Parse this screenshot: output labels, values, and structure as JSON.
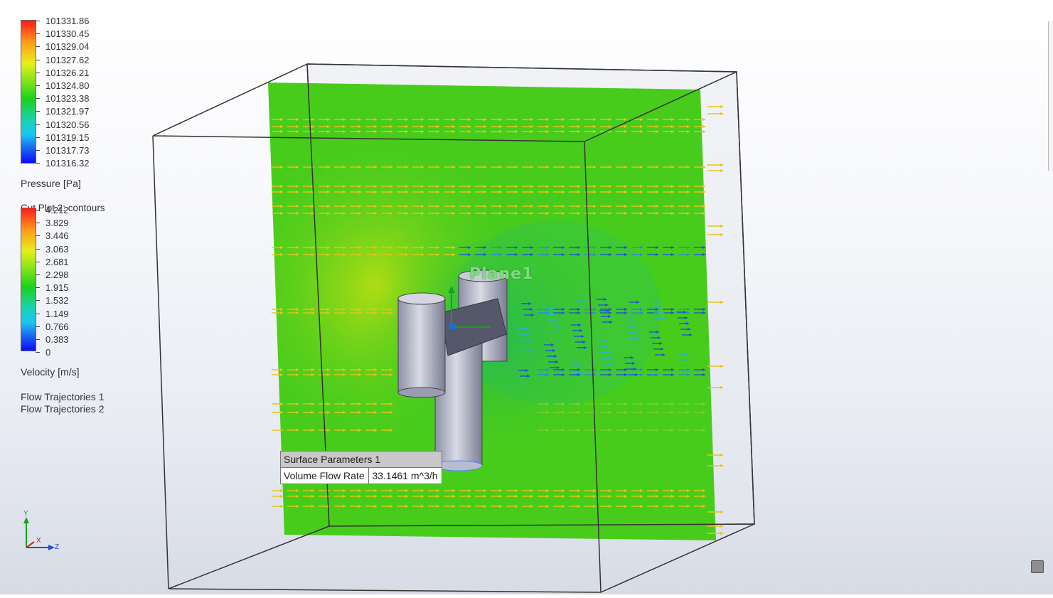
{
  "pressure_legend": {
    "ticks": [
      "101331.86",
      "101330.45",
      "101329.04",
      "101327.62",
      "101326.21",
      "101324.80",
      "101323.38",
      "101321.97",
      "101320.56",
      "101319.15",
      "101317.73",
      "101316.32"
    ],
    "title": "Pressure [Pa]"
  },
  "velocity_legend": {
    "header": "Cut Plot 2: contours",
    "ticks": [
      "4.212",
      "3.829",
      "3.446",
      "3.063",
      "2.681",
      "2.298",
      "1.915",
      "1.532",
      "1.149",
      "0.766",
      "0.383",
      "0"
    ],
    "title": "Velocity [m/s]"
  },
  "trajectories": [
    "Flow Trajectories 1",
    "Flow Trajectories 2"
  ],
  "plane_label": "Plane1",
  "surface_parameters": {
    "title": "Surface Parameters 1",
    "param_name": "Volume Flow Rate",
    "param_value": "33.1461 m^3/h"
  },
  "triad": {
    "y": "Y",
    "x": "X",
    "z": "Z"
  },
  "colors": {
    "background": "#eef0f5",
    "cut_plane": "#48cc1c",
    "arrow_warm": "#e6c31e",
    "arrow_cool": "#1e55d8",
    "geometry": "#a8abbd"
  }
}
